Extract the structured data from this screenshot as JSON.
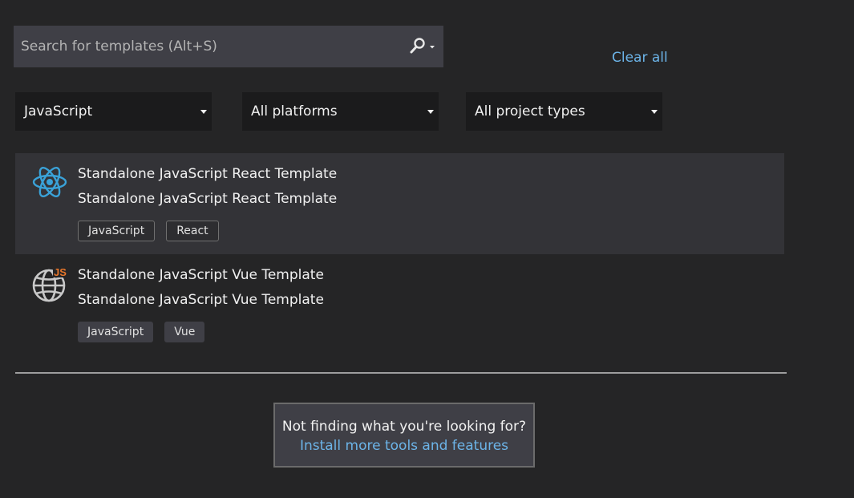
{
  "search": {
    "placeholder": "Search for templates (Alt+S)",
    "value": "",
    "search_icon": "search-icon",
    "dropdown_icon": "chevron-down-icon"
  },
  "clear_all_label": "Clear all",
  "filters": {
    "language": "JavaScript",
    "platform": "All platforms",
    "project_type": "All project types"
  },
  "templates": [
    {
      "title": "Standalone JavaScript React Template",
      "description": "Standalone JavaScript React Template",
      "icon": "react-atom-icon",
      "selected": true,
      "tags": [
        "JavaScript",
        "React"
      ]
    },
    {
      "title": "Standalone JavaScript Vue Template",
      "description": "Standalone JavaScript Vue Template",
      "icon": "globe-js-icon",
      "selected": false,
      "tags": [
        "JavaScript",
        "Vue"
      ]
    }
  ],
  "not_finding": {
    "question": "Not finding what you're looking for?",
    "link": "Install more tools and features"
  },
  "colors": {
    "background": "#252526",
    "accent_link": "#6cb4e8",
    "react_blue": "#3aa2d8",
    "js_orange": "#e8762a"
  }
}
